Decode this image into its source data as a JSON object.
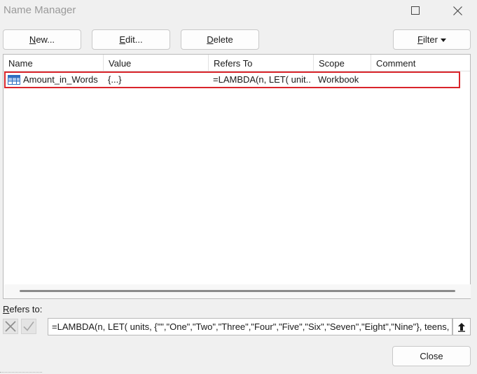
{
  "window": {
    "title": "Name Manager"
  },
  "toolbar": {
    "new_label_u": "N",
    "new_label_rest": "ew...",
    "edit_label_u": "E",
    "edit_label_rest": "dit...",
    "delete_label_u": "D",
    "delete_label_rest": "elete",
    "filter_label_u": "F",
    "filter_label_rest": "ilter"
  },
  "list": {
    "columns": [
      "Name",
      "Value",
      "Refers To",
      "Scope",
      "Comment"
    ],
    "rows": [
      {
        "name": "Amount_in_Words",
        "value": "{...}",
        "refers_to": "=LAMBDA(n, LET( unit...",
        "scope": "Workbook",
        "comment": "",
        "icon": "table-name-icon",
        "highlighted": true
      }
    ]
  },
  "refers": {
    "label_u": "R",
    "label_rest": "efers to:",
    "value": "=LAMBDA(n, LET( units, {\"\",\"One\",\"Two\",\"Three\",\"Four\",\"Five\",\"Six\",\"Seven\",\"Eight\",\"Nine\"}, teens, {\"T"
  },
  "footer": {
    "close_label": "Close"
  },
  "colors": {
    "highlight_border": "#d9252b",
    "window_bg": "#f0f0f0"
  }
}
